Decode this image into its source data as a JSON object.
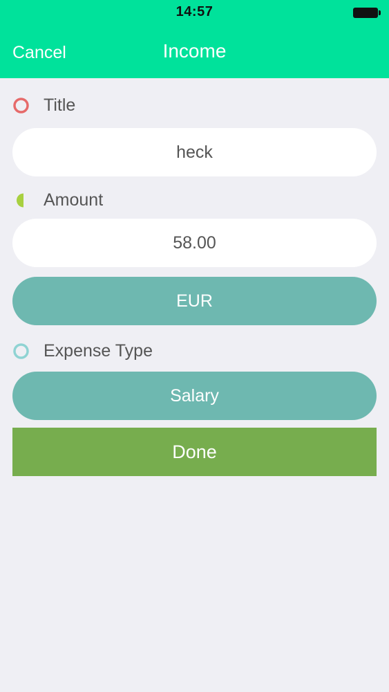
{
  "status_bar": {
    "time": "14:57"
  },
  "nav": {
    "cancel_label": "Cancel",
    "title": "Income"
  },
  "form": {
    "title_label": "Title",
    "title_value": "heck",
    "amount_label": "Amount",
    "amount_value": "58.00",
    "currency_label": "EUR",
    "expense_type_label": "Expense Type",
    "expense_type_value": "Salary",
    "done_label": "Done"
  },
  "colors": {
    "header": "#00e29b",
    "background": "#efeff4",
    "pill_button": "#6eb8b0",
    "done_button": "#77ad4e",
    "title_marker": "#e66a6a",
    "amount_marker": "#a8d040",
    "type_marker": "#8fd3d3"
  },
  "icons": {
    "title": "ring-icon",
    "amount": "half-circle-icon",
    "expense_type": "ring-icon",
    "battery": "battery-icon"
  }
}
